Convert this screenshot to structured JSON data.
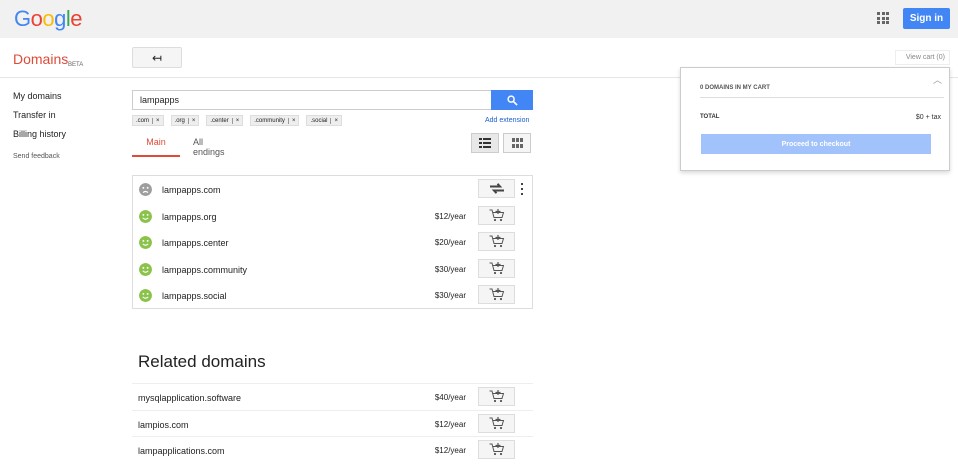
{
  "header": {
    "logo_letters": [
      "G",
      "o",
      "o",
      "g",
      "l",
      "e"
    ],
    "signin_label": "Sign in"
  },
  "brand": {
    "name": "Domains",
    "badge": "BETA"
  },
  "back_button": {
    "glyph": "↤"
  },
  "sidebar": {
    "items": [
      {
        "label": "My domains"
      },
      {
        "label": "Transfer in"
      },
      {
        "label": "Billing history"
      }
    ],
    "feedback": "Send feedback"
  },
  "search": {
    "value": "lampapps",
    "extensions": [
      ".com",
      ".org",
      ".center",
      ".community",
      ".social"
    ],
    "chip_close": "×",
    "add_extension": "Add extension"
  },
  "tabs": [
    {
      "label": "Main",
      "active": true
    },
    {
      "label": "All endings",
      "active": false
    }
  ],
  "results": [
    {
      "domain": "lampapps.com",
      "available": false,
      "price": ""
    },
    {
      "domain": "lampapps.org",
      "available": true,
      "price": "$12/year"
    },
    {
      "domain": "lampapps.center",
      "available": true,
      "price": "$20/year"
    },
    {
      "domain": "lampapps.community",
      "available": true,
      "price": "$30/year"
    },
    {
      "domain": "lampapps.social",
      "available": true,
      "price": "$30/year"
    }
  ],
  "related": {
    "title": "Related domains",
    "items": [
      {
        "domain": "mysqlapplication.software",
        "price": "$40/year"
      },
      {
        "domain": "lampios.com",
        "price": "$12/year"
      },
      {
        "domain": "lampapplications.com",
        "price": "$12/year"
      }
    ]
  },
  "cart": {
    "view_cart": "View cart (0)",
    "count_label": "0 DOMAINS IN MY CART",
    "total_label": "TOTAL",
    "total_value": "$0 + tax",
    "checkout_label": "Proceed to checkout"
  },
  "colors": {
    "accent_blue": "#4285f4",
    "brand_red": "#dd4b39",
    "available_green": "#8bc34a",
    "unavailable_grey": "#9e9e9e"
  }
}
